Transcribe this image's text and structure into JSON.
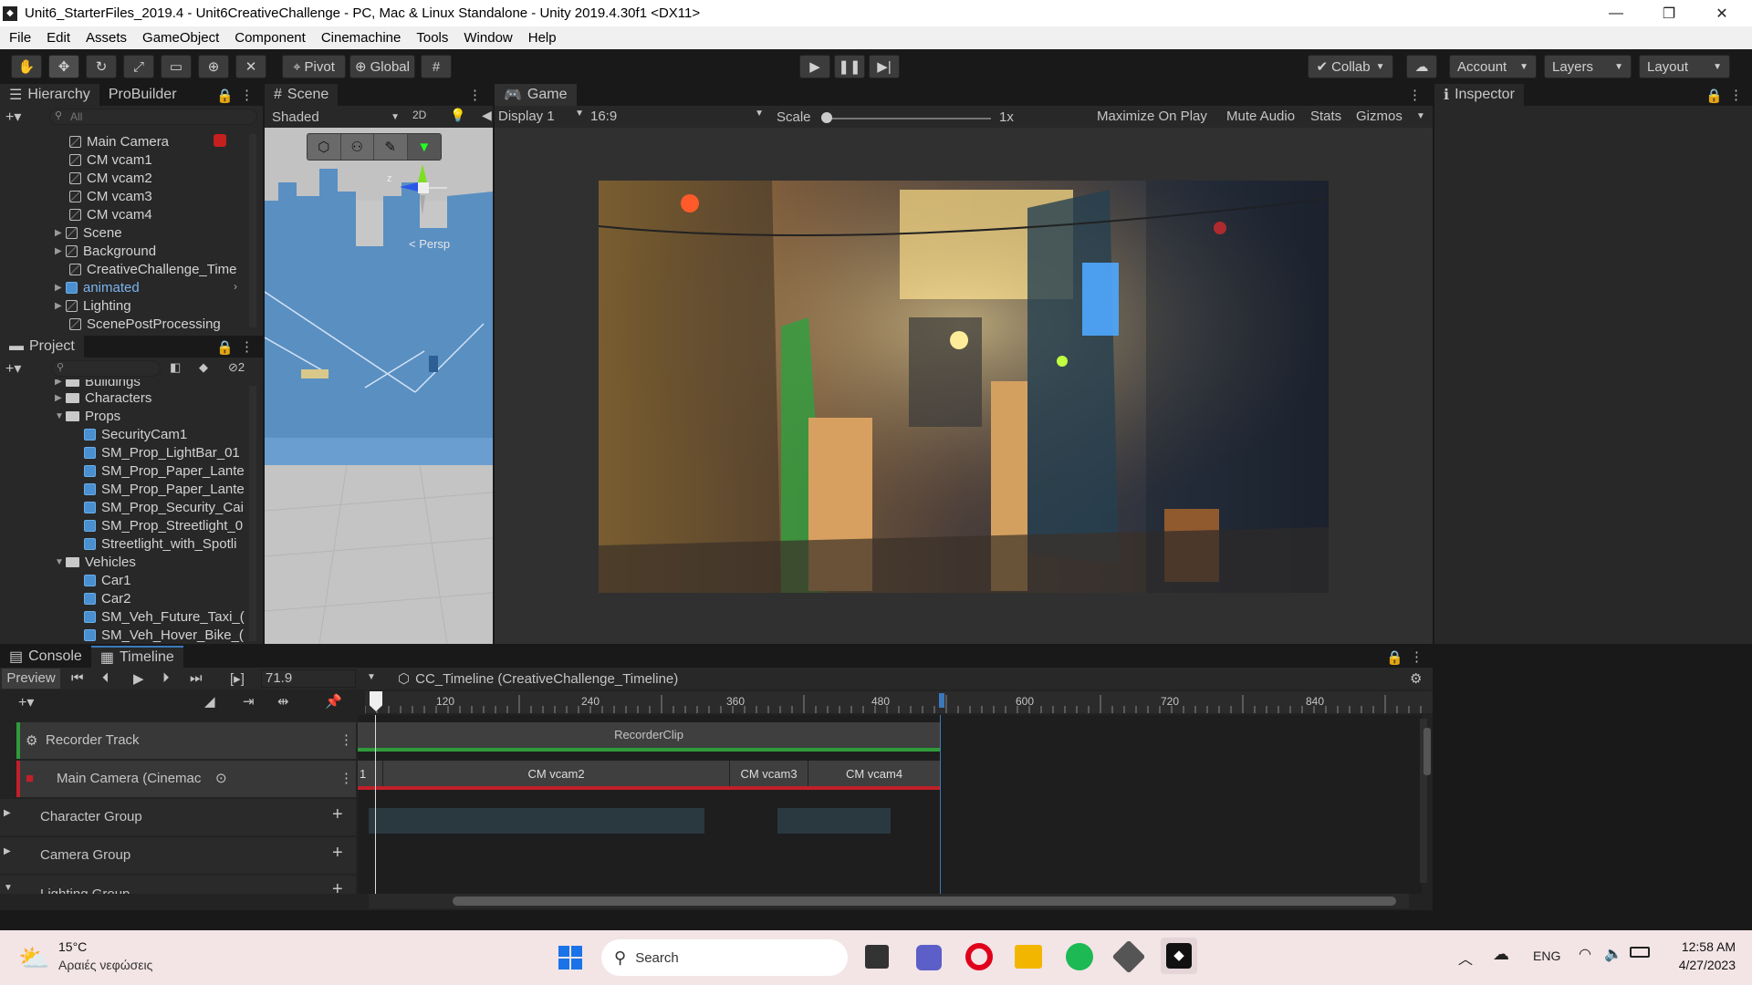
{
  "window": {
    "title": "Unit6_StarterFiles_2019.4 - Unit6CreativeChallenge - PC, Mac & Linux Standalone - Unity 2019.4.30f1 <DX11>",
    "controls": [
      "—",
      "❐",
      "✕"
    ]
  },
  "menu": [
    "File",
    "Edit",
    "Assets",
    "GameObject",
    "Component",
    "Cinemachine",
    "Tools",
    "Window",
    "Help"
  ],
  "toolbar": {
    "pivot": "Pivot",
    "global": "Global",
    "collab": "Collab",
    "account": "Account",
    "layers": "Layers",
    "layout": "Layout"
  },
  "hierarchy": {
    "tabs": [
      "Hierarchy",
      "ProBuilder"
    ],
    "search_placeholder": "All",
    "items": [
      "Main Camera",
      "CM vcam1",
      "CM vcam2",
      "CM vcam3",
      "CM vcam4",
      "Scene",
      "Background",
      "CreativeChallenge_Time",
      "animated",
      "Lighting",
      "ScenePostProcessing"
    ]
  },
  "project": {
    "tab": "Project",
    "hidden_count": "2",
    "items": [
      "Buildings",
      "Characters",
      "Props",
      "SecurityCam1",
      "SM_Prop_LightBar_01",
      "SM_Prop_Paper_Lante",
      "SM_Prop_Paper_Lante",
      "SM_Prop_Security_Cai",
      "SM_Prop_Streetlight_0",
      "Streetlight_with_Spotli",
      "Vehicles",
      "Car1",
      "Car2",
      "SM_Veh_Future_Taxi_(",
      "SM_Veh_Hover_Bike_("
    ]
  },
  "scene": {
    "tab": "Scene",
    "shading": "Shaded",
    "mode2d": "2D",
    "persp": "< Persp",
    "axis_z": "z"
  },
  "game": {
    "tab": "Game",
    "display": "Display 1",
    "aspect": "16:9",
    "scale_label": "Scale",
    "scale_value": "1x",
    "maximize": "Maximize On Play",
    "mute": "Mute Audio",
    "stats": "Stats",
    "gizmos": "Gizmos"
  },
  "inspector": {
    "tab": "Inspector"
  },
  "console": {
    "tab": "Console"
  },
  "timeline": {
    "tab": "Timeline",
    "preview": "Preview",
    "frame": "71.9",
    "asset": "CC_Timeline (CreativeChallenge_Timeline)",
    "ruler": [
      "120",
      "240",
      "360",
      "480",
      "600",
      "720",
      "840"
    ],
    "tracks": [
      {
        "name": "Recorder Track",
        "color": "#2f9b3a"
      },
      {
        "name": "Main Camera (Cinemac",
        "color": "#c0202a"
      },
      {
        "name": "Character Group",
        "color": ""
      },
      {
        "name": "Camera Group",
        "color": ""
      },
      {
        "name": "Lighting Group",
        "color": ""
      }
    ],
    "recorder_clip": "RecorderClip",
    "camera_clips": [
      "1",
      "CM vcam2",
      "CM vcam3",
      "CM vcam4"
    ]
  },
  "taskbar": {
    "weather_temp": "15°C",
    "weather_desc": "Αραιές νεφώσεις",
    "search": "Search",
    "lang": "ENG",
    "time": "12:58 AM",
    "date": "4/27/2023"
  }
}
